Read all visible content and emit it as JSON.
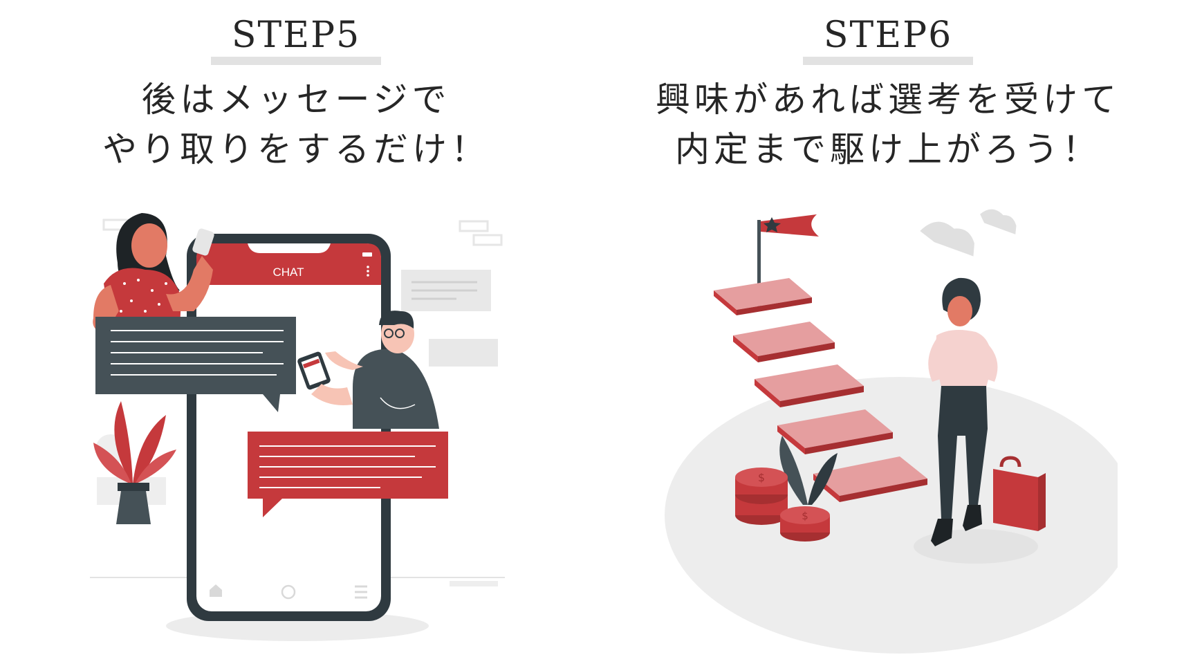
{
  "steps": [
    {
      "label": "STEP5",
      "caption_lines": [
        "後はメッセージで",
        "やり取りをするだけ！"
      ],
      "phone": {
        "header_title": "CHAT"
      }
    },
    {
      "label": "STEP6",
      "caption_lines": [
        "興味があれば選考を受けて",
        "内定まで駆け上がろう！"
      ]
    }
  ],
  "colors": {
    "accent_red": "#c5393c",
    "light_red": "#e59e9f",
    "dark_slate": "#455157",
    "skin": "#e27a65",
    "gray": "#e0e0e0"
  }
}
